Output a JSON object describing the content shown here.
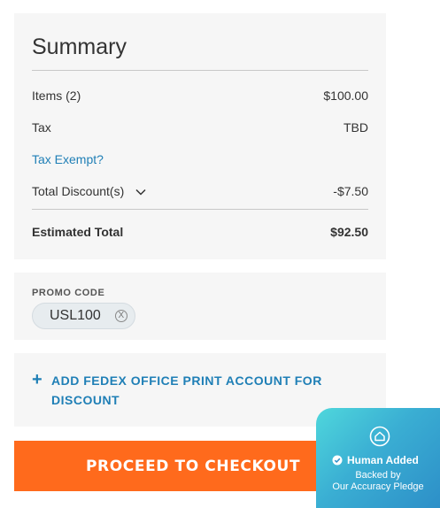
{
  "summary": {
    "title": "Summary",
    "items_label": "Items (2)",
    "items_value": "$100.00",
    "tax_label": "Tax",
    "tax_value": "TBD",
    "tax_exempt_link": "Tax Exempt?",
    "discount_label": "Total Discount(s)",
    "discount_value": "-$7.50",
    "total_label": "Estimated Total",
    "total_value": "$92.50"
  },
  "promo": {
    "label": "PROMO CODE",
    "code": "USL100",
    "remove_glyph": "X"
  },
  "account": {
    "plus_glyph": "+",
    "text": "ADD FEDEX OFFICE PRINT ACCOUNT FOR DISCOUNT"
  },
  "checkout": {
    "label": "PROCEED TO CHECKOUT"
  },
  "badge": {
    "title": "Human Added",
    "line1": "Backed by",
    "line2": "Our Accuracy Pledge"
  },
  "icons": {
    "chevron": "chevron-down-icon",
    "remove": "close-circle-icon",
    "plus": "plus-icon",
    "badge": "home-badge-icon",
    "check": "check-circle-icon"
  },
  "colors": {
    "accent": "#1f7fb6",
    "checkout": "#ff6a1c",
    "card_bg": "#f6f6f6"
  }
}
